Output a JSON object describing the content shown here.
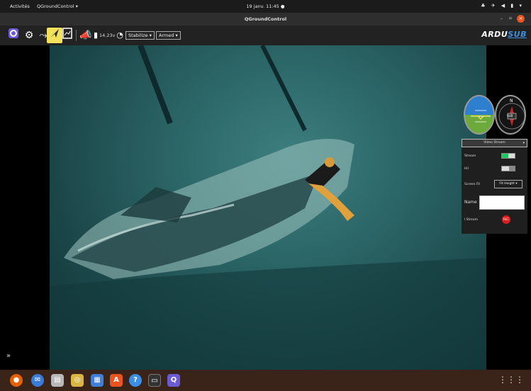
{
  "gnome_bar": {
    "activities": "Activités",
    "app_name": "QGroundControl ▾",
    "clock": "19 janv. 11:45 ●",
    "tray": "♣ ✈ ◀ ▮ ▾"
  },
  "window": {
    "title": "QGroundControl",
    "minimize": "–",
    "maximize": "=",
    "close": "×"
  },
  "toolbar": {
    "battery_voltage": "14.23v",
    "flight_mode": "Stabilize ▾",
    "arm_state": "Armed ▾",
    "logo_main": "ARDU",
    "logo_sub": "SUB"
  },
  "instruments": {
    "compass_north": "N",
    "compass_heading": "SUB"
  },
  "video_panel": {
    "header": "Video Stream",
    "stream_label": "Stream",
    "grid_label": "Hil",
    "screen_fit_label": "Screen Fit",
    "screen_fit_value": "Fit Height ▾",
    "file_name_label": "Name",
    "record_label": "l Stream",
    "record_button": "REC"
  },
  "sidebar": {
    "expand_icon_glyph": "»"
  },
  "colors": {
    "accent_yellow": "#f2e15a",
    "rec_red": "#d91c1c",
    "switch_on": "#22c55e",
    "ubuntu_orange": "#e95420"
  }
}
